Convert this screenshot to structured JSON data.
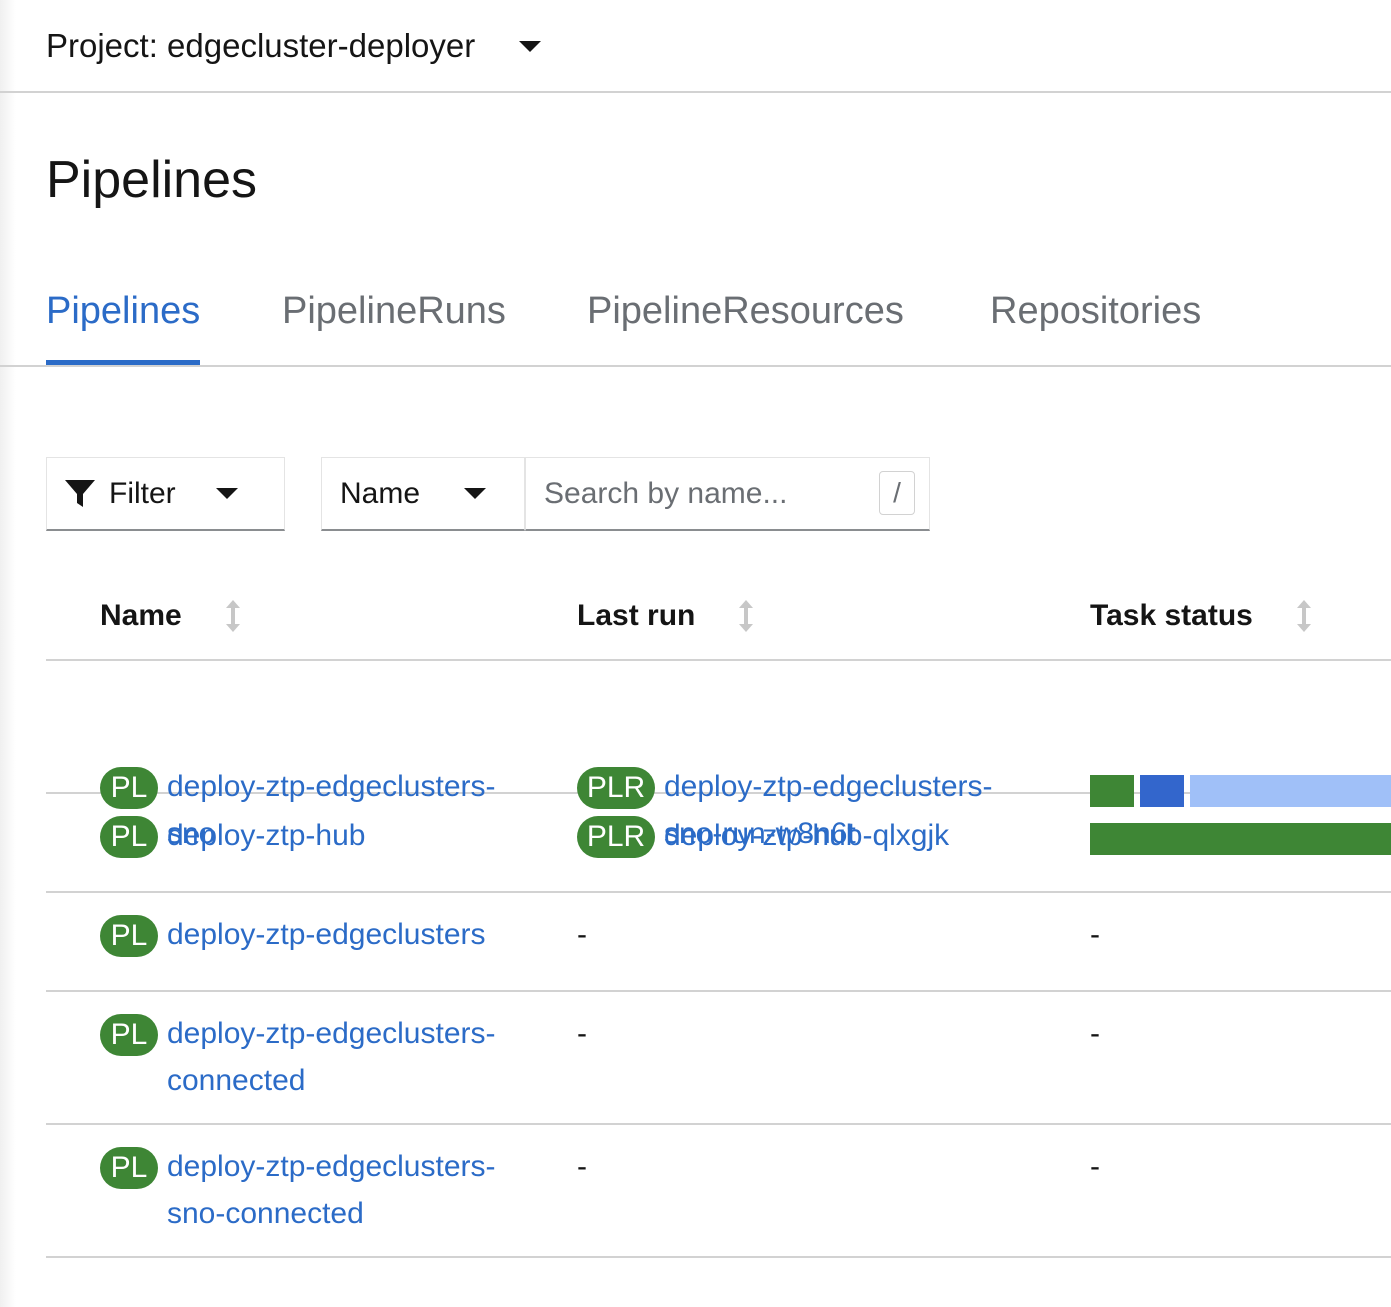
{
  "project": {
    "label": "Project: edgecluster-deployer"
  },
  "page": {
    "title": "Pipelines"
  },
  "tabs": [
    {
      "label": "Pipelines",
      "active": true
    },
    {
      "label": "PipelineRuns",
      "active": false
    },
    {
      "label": "PipelineResources",
      "active": false
    },
    {
      "label": "Repositories",
      "active": false
    }
  ],
  "toolbar": {
    "filter_label": "Filter",
    "attribute_label": "Name",
    "search_placeholder": "Search by name...",
    "search_value": "",
    "shortcut_hint": "/"
  },
  "table": {
    "columns": [
      "Name",
      "Last run",
      "Task status"
    ],
    "rows": [
      {
        "badge": "PL",
        "name_lines": [
          "deploy-ztp-edgeclusters-",
          "sno"
        ],
        "run_badge": "PLR",
        "run_lines": [
          "deploy-ztp-edgeclusters-",
          "sno-run-w8n6t"
        ],
        "task_status": [
          {
            "state": "succeeded",
            "color": "#3e8635"
          },
          {
            "state": "running",
            "color": "#3366cc"
          },
          {
            "state": "pending",
            "color": "#a0c0f8"
          }
        ]
      },
      {
        "badge": "PL",
        "name_lines": [
          "deploy-ztp-hub"
        ],
        "run_badge": "PLR",
        "run_lines": [
          "deploy-ztp-hub-qlxgjk"
        ],
        "task_status": [
          {
            "state": "succeeded",
            "color": "#3e8635"
          }
        ]
      },
      {
        "badge": "PL",
        "name_lines": [
          "deploy-ztp-edgeclusters"
        ],
        "last_run_empty": "-",
        "task_status_empty": "-"
      },
      {
        "badge": "PL",
        "name_lines": [
          "deploy-ztp-edgeclusters-",
          "connected"
        ],
        "last_run_empty": "-",
        "task_status_empty": "-"
      },
      {
        "badge": "PL",
        "name_lines": [
          "deploy-ztp-edgeclusters-",
          "sno-connected"
        ],
        "last_run_empty": "-",
        "task_status_empty": "-"
      }
    ]
  },
  "colors": {
    "link": "#2b6bc7",
    "badge": "#3e8635",
    "border": "#d2d2d2",
    "muted": "#6a6e73"
  },
  "icons": [
    "caret-down-icon",
    "filter-icon",
    "sort-icon"
  ]
}
